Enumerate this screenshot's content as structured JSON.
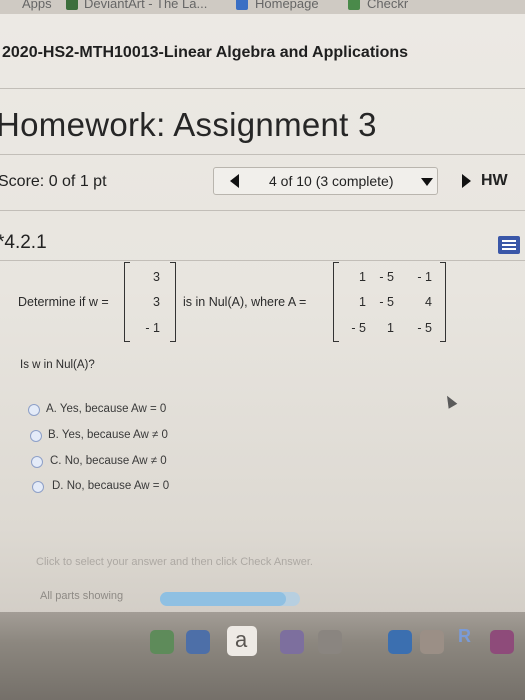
{
  "browser": {
    "bookmarks": [
      "Apps",
      "DeviantArt - The La...",
      "Homepage",
      "Checkr"
    ]
  },
  "course": {
    "title": "2020-HS2-MTH10013-Linear Algebra and Applications"
  },
  "homework": {
    "title": "Homework: Assignment 3"
  },
  "score": {
    "text": "Score: 0 of 1 pt"
  },
  "navigation": {
    "status": "4 of 10 (3 complete)",
    "hw_link": "HW"
  },
  "question": {
    "number": "*4.2.1",
    "determine_label": "Determine if w =",
    "nul_label": "is in Nul(A), where A =",
    "w_vector": [
      "3",
      "3",
      "- 1"
    ],
    "matrix_A": [
      [
        "1",
        "- 5",
        "- 1"
      ],
      [
        "1",
        "- 5",
        "4"
      ],
      [
        "- 5",
        "1",
        "- 5"
      ]
    ],
    "prompt": "Is w in Nul(A)?",
    "options": [
      "A.  Yes, because Aw = 0",
      "B.  Yes, because Aw ≠ 0",
      "C.  No, because Aw ≠ 0",
      "D.  No, because Aw = 0"
    ]
  },
  "footer": {
    "hint": "Click to select your answer and then click Check Answer.",
    "parts_label": "All parts showing",
    "progress": 0.9
  },
  "dock": {
    "app_letter": "a",
    "app_r": "R"
  },
  "colors": {
    "accent": "#3a57a8",
    "radio_fill": "#e4ebf8",
    "progress": "#8fc0e2"
  }
}
